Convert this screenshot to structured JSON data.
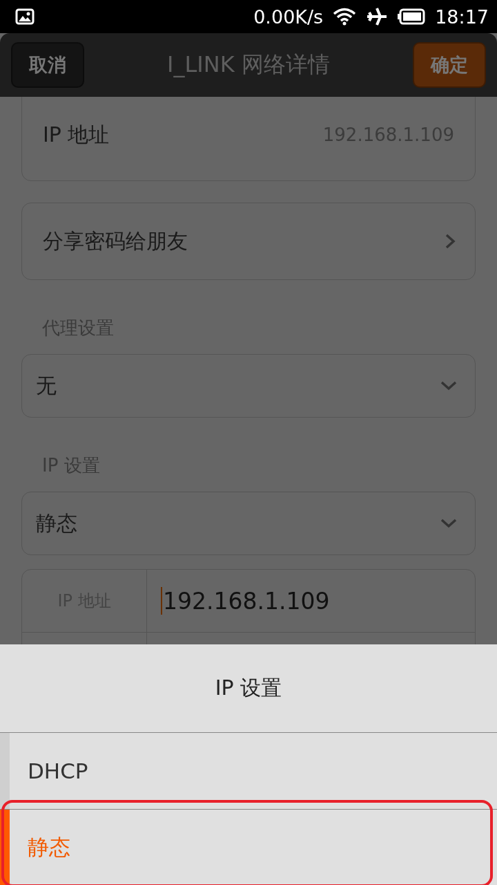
{
  "status_bar": {
    "speed": "0.00K/s",
    "time": "18:17"
  },
  "action_bar": {
    "cancel": "取消",
    "title": "I_LINK 网络详情",
    "confirm": "确定"
  },
  "ip_row": {
    "label": "IP 地址",
    "value": "192.168.1.109"
  },
  "share_row": {
    "label": "分享密码给朋友"
  },
  "proxy": {
    "label": "代理设置",
    "value": "无"
  },
  "ip_settings": {
    "label": "IP 设置",
    "value": "静态"
  },
  "form": {
    "rows": [
      {
        "label": "IP 地址",
        "value": "192.168.1.109"
      }
    ]
  },
  "sheet": {
    "title": "IP 设置",
    "options": [
      {
        "label": "DHCP",
        "selected": false,
        "circled": false
      },
      {
        "label": "静态",
        "selected": true,
        "circled": true
      }
    ]
  }
}
